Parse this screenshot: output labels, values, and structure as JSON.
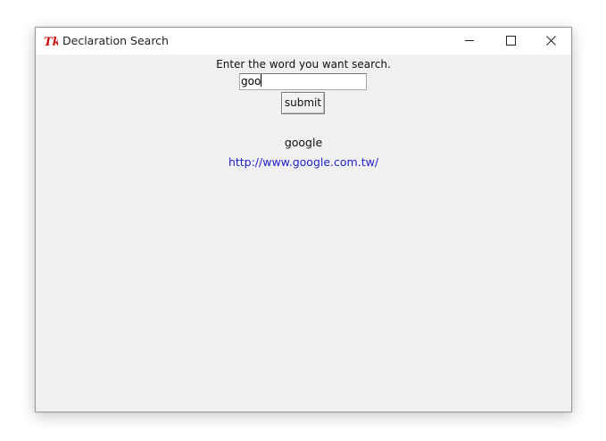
{
  "window": {
    "title": "Declaration Search",
    "app_icon": "tk-feather-icon",
    "controls": {
      "minimize": "minimize-icon",
      "maximize": "maximize-icon",
      "close": "close-icon"
    }
  },
  "form": {
    "prompt": "Enter the word you want search.",
    "input_value": "goo",
    "submit_label": "submit"
  },
  "result": {
    "word": "google",
    "url": "http://www.google.com.tw/"
  },
  "colors": {
    "link": "#2222cc",
    "icon_red": "#cc1111"
  }
}
